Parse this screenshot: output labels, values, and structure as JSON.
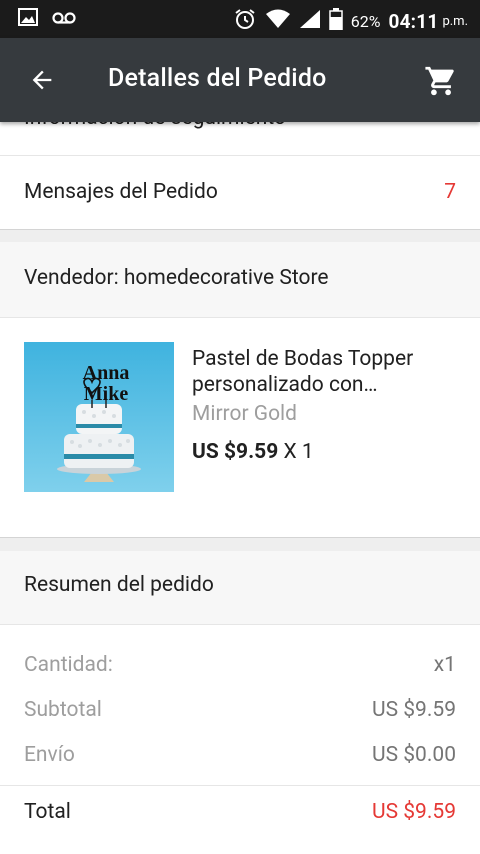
{
  "status_bar": {
    "battery_pct": "62%",
    "time": "04:11",
    "ampm": "p.m."
  },
  "app_bar": {
    "title": "Detalles del Pedido"
  },
  "tracking": {
    "label": "Información de seguimiento"
  },
  "messages": {
    "label": "Mensajes del Pedido",
    "count": "7"
  },
  "seller": {
    "label": "Vendedor: homedecorative Store"
  },
  "product": {
    "name_line1": "Pastel de Bodas Topper",
    "name_line2": "personalizado con…",
    "variant": "Mirror Gold",
    "price": "US $9.59",
    "qty": " X 1",
    "image_text_1": "Anna",
    "image_text_2": "Mike"
  },
  "summary": {
    "header": "Resumen del pedido",
    "quantity_label": "Cantidad:",
    "quantity_value": "x1",
    "subtotal_label": "Subtotal",
    "subtotal_value": "US $9.59",
    "shipping_label": "Envío",
    "shipping_value": "US $0.00",
    "total_label": "Total",
    "total_value": "US $9.59"
  },
  "colors": {
    "app_bar": "#363a3e",
    "status_bar": "#1b1b1b",
    "accent_red": "#e53935"
  }
}
